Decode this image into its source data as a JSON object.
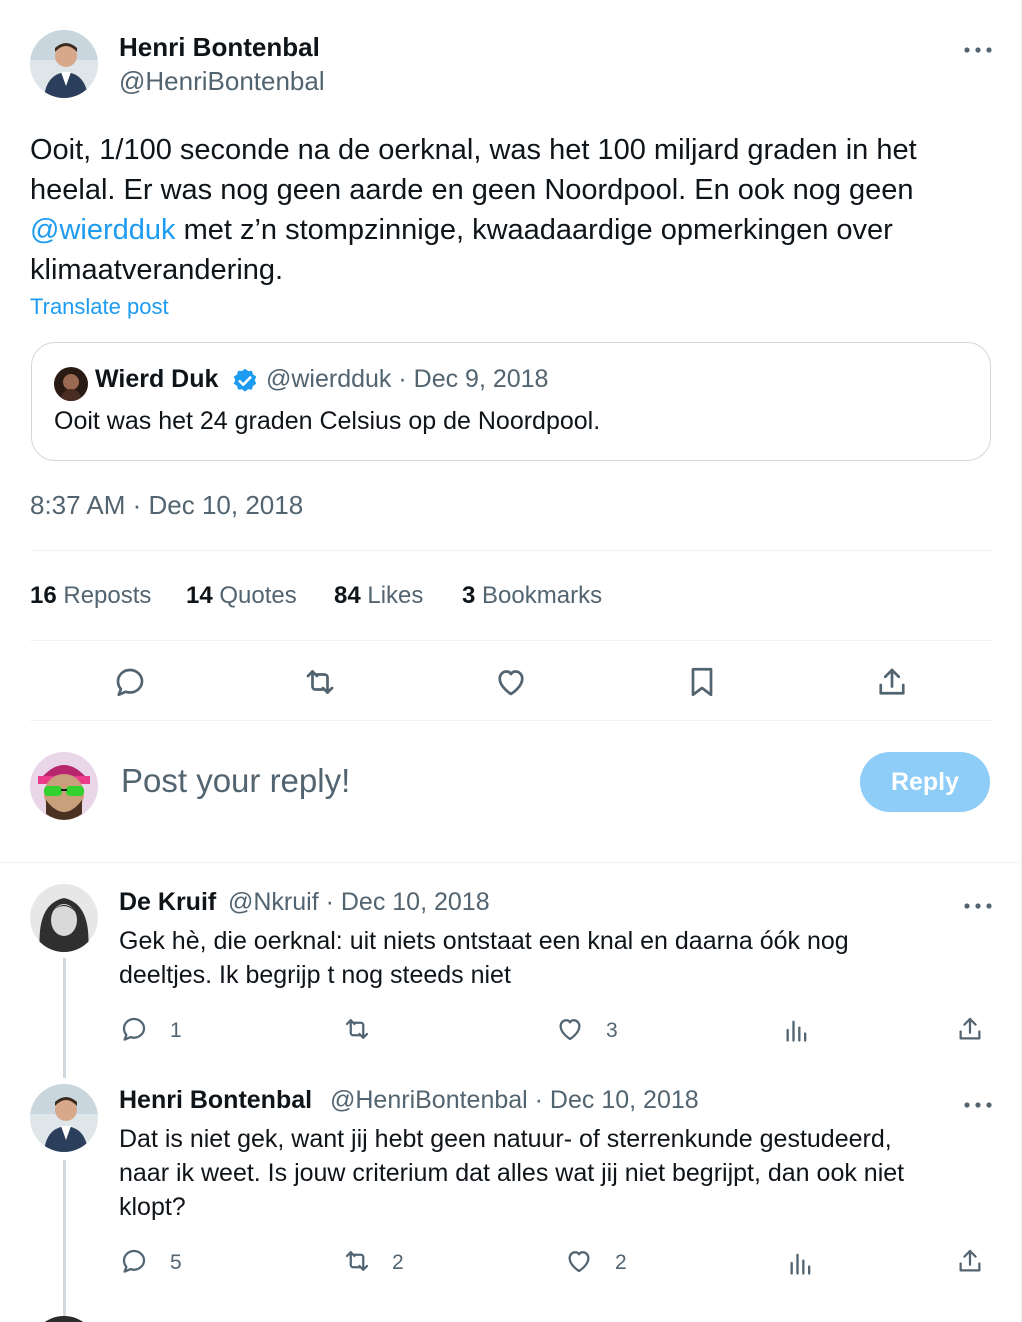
{
  "tweet": {
    "author_name": "Henri Bontenbal",
    "author_handle": "@HenriBontenbal",
    "text_lines": [
      "Ooit, 1/100 seconde na de oerknal, was het 100 miljard graden in het",
      "heelal. Er was nog geen aarde en geen Noordpool. En ook nog geen",
      "met z’n stompzinnige, kwaadaardige opmerkingen over",
      "klimaatverandering."
    ],
    "mention": "@wierdduk",
    "translate_label": "Translate post",
    "timestamp": "8:37 AM · Dec 10, 2018"
  },
  "quoted": {
    "author_name": "Wierd Duk",
    "meta": "@wierdduk · Dec 9, 2018",
    "text": "Ooit was het 24 graden Celsius op de Noordpool."
  },
  "stats": {
    "reposts_count": "16",
    "reposts_label": "Reposts",
    "quotes_count": "14",
    "quotes_label": "Quotes",
    "likes_count": "84",
    "likes_label": "Likes",
    "bookmarks_count": "3",
    "bookmarks_label": "Bookmarks"
  },
  "actions": [
    "reply-icon",
    "repost-icon",
    "like-icon",
    "bookmark-icon",
    "share-icon"
  ],
  "composer": {
    "placeholder": "Post your reply!",
    "reply_button": "Reply"
  },
  "replies": [
    {
      "author_name": "De Kruif",
      "meta": "@Nkruif · Dec 10, 2018",
      "text_lines": [
        "Gek hè,  die oerknal: uit niets ontstaat een knal en daarna óók nog",
        "deeltjes.  Ik begrijp t nog steeds niet"
      ],
      "reply_count": "1",
      "repost_count": "",
      "like_count": "3"
    },
    {
      "author_name": "Henri Bontenbal",
      "meta": "@HenriBontenbal · Dec 10, 2018",
      "text_lines": [
        "Dat is niet gek, want jij hebt geen natuur- of sterrenkunde gestudeerd,",
        "naar ik weet. Is jouw criterium dat alles wat jij niet begrijpt, dan ook niet",
        "klopt?"
      ],
      "reply_count": "5",
      "repost_count": "2",
      "like_count": "2"
    }
  ],
  "colors": {
    "accent": "#1d9bf0",
    "muted": "#536471",
    "reply_button_disabled": "#8ecdf8"
  }
}
